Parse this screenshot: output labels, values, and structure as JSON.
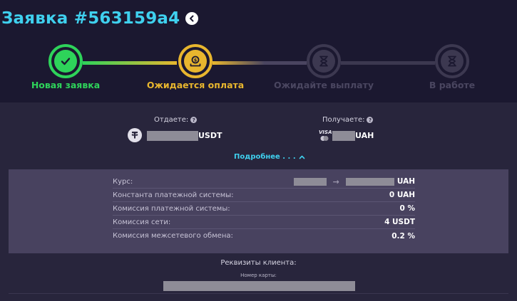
{
  "header": {
    "title": "Заявка #563159a4",
    "back_icon": "chevron-left-icon"
  },
  "stepper": {
    "steps": [
      {
        "label": "Новая заявка",
        "state": "done",
        "icon": "check-icon",
        "color": "#2ed35a"
      },
      {
        "label": "Ожидается оплата",
        "state": "active",
        "icon": "money-bag-icon",
        "color": "#e8b62e"
      },
      {
        "label": "Ожидайте выплату",
        "state": "pending",
        "icon": "hourglass-icon",
        "color": "#3c3850"
      },
      {
        "label": "В работе",
        "state": "pending",
        "icon": "hourglass-icon",
        "color": "#3c3850"
      }
    ]
  },
  "exchange": {
    "give_label": "Отдаете:",
    "give_currency": "USDT",
    "give_icon": "tether-icon",
    "get_label": "Получаете:",
    "get_currency": "UAH",
    "get_icon": "visa-mastercard-icon",
    "help_icon": "question-icon"
  },
  "more_link": "Подробнее . . .",
  "details": {
    "rows": [
      {
        "label": "Курс:",
        "value": "UAH"
      },
      {
        "label": "Константа платежной системы:",
        "value": "0 UAH"
      },
      {
        "label": "Комиссия платежной системы:",
        "value": "0 %"
      },
      {
        "label": "Комиссия сети:",
        "value": "4 USDT"
      },
      {
        "label": "Комиссия межсетевого обмена:",
        "value": "0.2 %"
      }
    ],
    "rate_arrow": "→"
  },
  "client": {
    "title": "Реквизиты клиента:",
    "card_label": "Номер карты:"
  },
  "colors": {
    "accent": "#3fd0ee",
    "success": "#2ed35a",
    "warning": "#e8b62e",
    "background": "#1b1830",
    "panel": "#28253c",
    "details": "#48425f"
  }
}
